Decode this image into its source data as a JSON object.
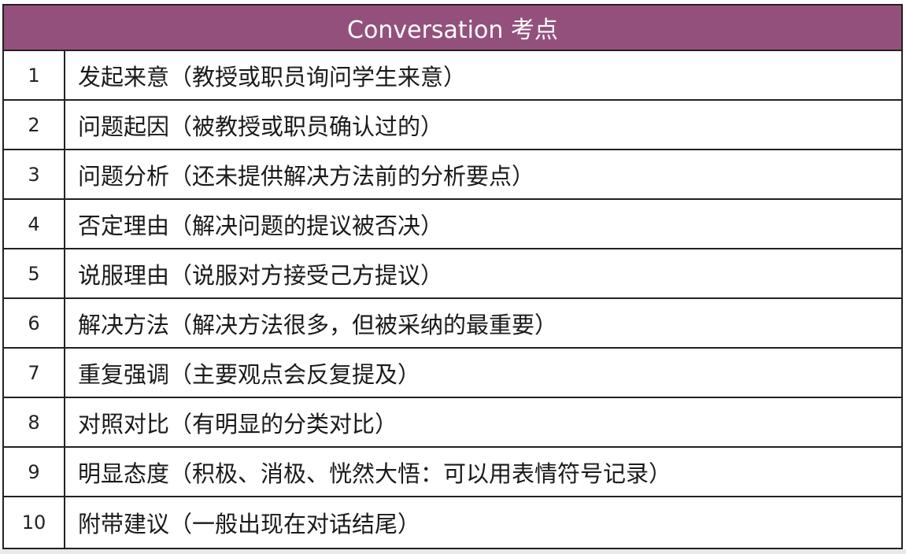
{
  "header": {
    "title": "Conversation 考点"
  },
  "rows": [
    {
      "num": "1",
      "text": "发起来意（教授或职员询问学生来意）"
    },
    {
      "num": "2",
      "text": "问题起因（被教授或职员确认过的）"
    },
    {
      "num": "3",
      "text": "问题分析（还未提供解决方法前的分析要点）"
    },
    {
      "num": "4",
      "text": "否定理由（解决问题的提议被否决）"
    },
    {
      "num": "5",
      "text": "说服理由（说服对方接受己方提议）"
    },
    {
      "num": "6",
      "text": "解决方法（解决方法很多，但被采纳的最重要）"
    },
    {
      "num": "7",
      "text": "重复强调（主要观点会反复提及）"
    },
    {
      "num": "8",
      "text": "对照对比（有明显的分类对比）"
    },
    {
      "num": "9",
      "text": "明显态度（积极、消极、恍然大悟：可以用表情符号记录）"
    },
    {
      "num": "10",
      "text": "附带建议（一般出现在对话结尾）"
    }
  ],
  "colors": {
    "header_bg": "#94507c",
    "header_text": "#ffffff",
    "border": "#222222"
  }
}
